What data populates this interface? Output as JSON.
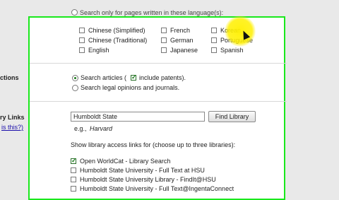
{
  "top_option": "Search only for pages written in these language(s):",
  "languages": [
    {
      "label": "Chinese (Simplified)",
      "checked": false
    },
    {
      "label": "Chinese (Traditional)",
      "checked": false
    },
    {
      "label": "English",
      "checked": false
    },
    {
      "label": "French",
      "checked": false
    },
    {
      "label": "German",
      "checked": false
    },
    {
      "label": "Japanese",
      "checked": false
    },
    {
      "label": "Korean",
      "checked": false
    },
    {
      "label": "Portuguese",
      "checked": false
    },
    {
      "label": "Spanish",
      "checked": false
    }
  ],
  "collections": {
    "side_label": "ctions",
    "search_articles": "Search articles (",
    "include_patents": "include patents).",
    "legal": "Search legal opinions and journals."
  },
  "library_links": {
    "side_label": "ry Links",
    "side_link": "is this?)",
    "input_value": "Humboldt State",
    "find_button": "Find Library",
    "example_prefix": "e.g.,",
    "example_value": "Harvard",
    "instruction": "Show library access links for (choose up to three libraries):",
    "libraries": [
      {
        "label": "Open WorldCat - Library Search",
        "checked": true
      },
      {
        "label": "Humboldt State University - Full Text at HSU",
        "checked": false
      },
      {
        "label": "Humboldt State University Library - FindIt@HSU",
        "checked": false
      },
      {
        "label": "Humboldt State University - Full Text@IngentaConnect",
        "checked": false
      }
    ]
  },
  "colors": {
    "panel_border": "#19e81c",
    "highlight": "#fff000",
    "link": "#1a0dab"
  }
}
